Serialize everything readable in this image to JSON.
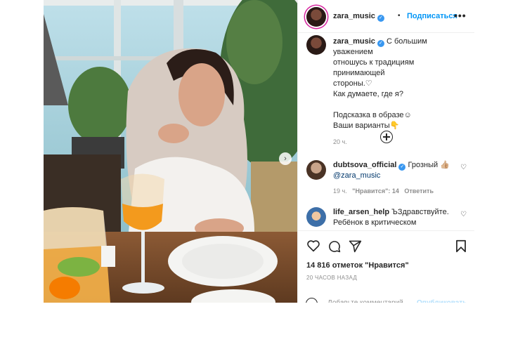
{
  "post": {
    "username": "zara_music",
    "follow_label": "Подписаться",
    "more_label": "•••",
    "separator": "•",
    "caption_lines": [
      "С большим уважением",
      "отношусь к традициям принимающей",
      "стороны.♡",
      "Как думаете, где я?",
      "",
      "Подсказка в образе☺",
      "Ваши варианты👇"
    ],
    "caption_time": "20 ч.",
    "next_arrow": "›"
  },
  "comments": [
    {
      "username": "dubtsova_official",
      "verified": true,
      "text": "Грозный 👍🏼",
      "line2": "@zara_music",
      "time": "19 ч.",
      "likes": "\"Нравится\": 14",
      "reply": "Ответить"
    },
    {
      "username": "life_arsen_help",
      "verified": false,
      "text": "ЪЗдравствуйте.",
      "line2": "Ребёнок в критическом"
    }
  ],
  "stats": {
    "likes": "14 816 отметок \"Нравится\"",
    "timestamp": "20 ЧАСОВ НАЗАД"
  },
  "composer": {
    "placeholder": "Добавьте комментарий...",
    "publish": "Опубликовать"
  }
}
